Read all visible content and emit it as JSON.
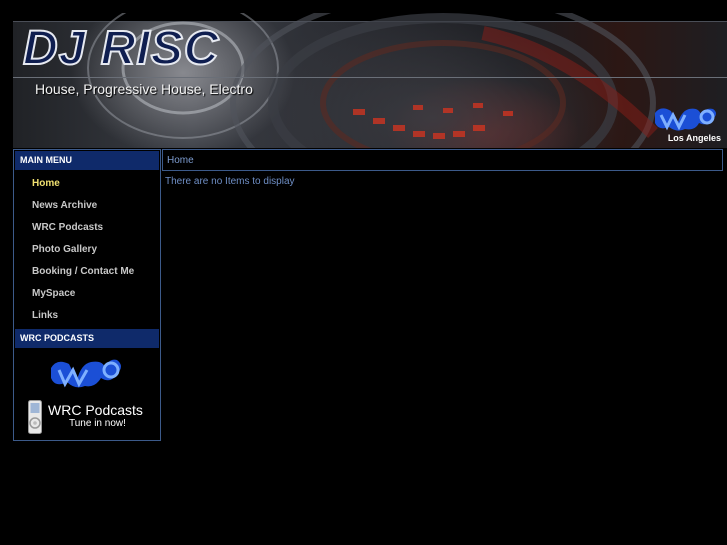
{
  "header": {
    "title": "DJ RISC",
    "subtitle": "House, Progressive House, Electro",
    "location": "Los Angeles",
    "logo_icon": "wrc-logo-icon"
  },
  "sidebar": {
    "main_menu_title": "MAIN MENU",
    "menu_items": [
      {
        "label": "Home",
        "active": true
      },
      {
        "label": "News Archive",
        "active": false
      },
      {
        "label": "WRC Podcasts",
        "active": false
      },
      {
        "label": "Photo Gallery",
        "active": false
      },
      {
        "label": "Booking / Contact Me",
        "active": false
      },
      {
        "label": "MySpace",
        "active": false
      },
      {
        "label": "Links",
        "active": false
      }
    ],
    "podcasts_title": "WRC PODCASTS",
    "promo": {
      "logo_icon": "wrc-logo-icon",
      "player_icon": "media-player-icon",
      "title": "WRC Podcasts",
      "subtitle": "Tune in now!"
    }
  },
  "main": {
    "breadcrumb": "Home",
    "empty_message": "There are no Items to display"
  },
  "colors": {
    "background": "#000000",
    "module_title_bg": "#0f2a6a",
    "active_menu": "#f0e070",
    "menu_text": "#c8c8c8",
    "link_text": "#7d9cd0",
    "border": "#3c5a8a"
  }
}
